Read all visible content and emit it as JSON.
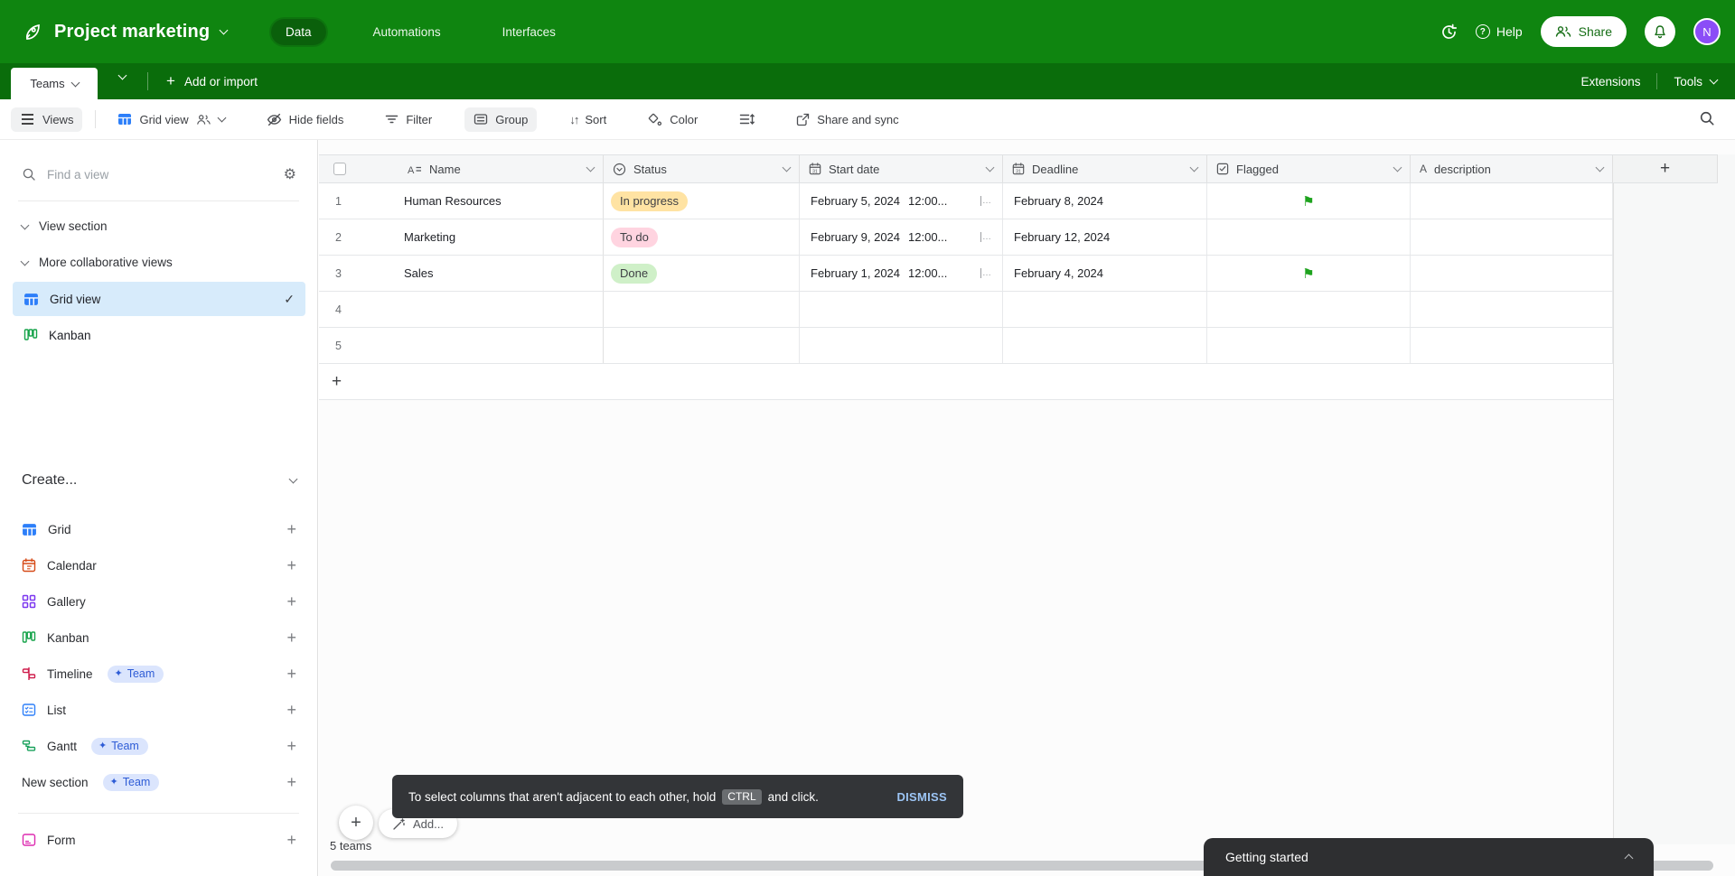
{
  "colors": {
    "brand_green": "#0f8510",
    "brand_green_dark": "#0a6d0b",
    "selected_view_bg": "#d7ebfb",
    "flag_green": "#1ea31e",
    "avatar_purple": "#8b4df7",
    "status_in_progress_bg": "#ffe3a3",
    "status_to_do_bg": "#ffd4e0",
    "status_done_bg": "#cff0c8"
  },
  "icons": {
    "plus": "+",
    "check": "✓",
    "sparkle": "✦",
    "gear": "⚙",
    "question_mark": "?",
    "sort": "↓↑",
    "flag": "⚑",
    "letter_a": "A"
  },
  "topbar": {
    "title": "Project marketing",
    "tabs": [
      {
        "label": "Data"
      },
      {
        "label": "Automations"
      },
      {
        "label": "Interfaces"
      }
    ],
    "help": "Help",
    "share": "Share",
    "avatar": "N"
  },
  "tabrow": {
    "active_table": "Teams",
    "add_or_import": "Add or import",
    "extensions": "Extensions",
    "tools": "Tools"
  },
  "toolbar": {
    "views": "Views",
    "view_name": "Grid view",
    "hide_fields": "Hide fields",
    "filter": "Filter",
    "group": "Group",
    "sort": "Sort",
    "color": "Color",
    "share_sync": "Share and sync"
  },
  "sidebar": {
    "find_placeholder": "Find a view",
    "section1": "View section",
    "section2": "More collaborative views",
    "views": [
      {
        "label": "Grid view",
        "selected": true
      },
      {
        "label": "Kanban"
      }
    ],
    "create": "Create...",
    "create_items": [
      {
        "label": "Grid"
      },
      {
        "label": "Calendar"
      },
      {
        "label": "Gallery"
      },
      {
        "label": "Kanban"
      },
      {
        "label": "Timeline",
        "badge": "Team"
      },
      {
        "label": "List"
      },
      {
        "label": "Gantt",
        "badge": "Team"
      },
      {
        "label": "New section",
        "badge": "Team"
      },
      {
        "label": "Form"
      }
    ]
  },
  "table": {
    "headers": {
      "name": "Name",
      "status": "Status",
      "start": "Start date",
      "deadline": "Deadline",
      "flagged": "Flagged",
      "description": "description"
    },
    "rows": [
      {
        "num": "1",
        "name": "Human Resources",
        "status": "In progress",
        "status_bg": "#ffe3a3",
        "start_date": "February 5, 2024",
        "start_time": "12:00...",
        "deadline": "February 8, 2024",
        "flagged": true
      },
      {
        "num": "2",
        "name": "Marketing",
        "status": "To do",
        "status_bg": "#ffd4e0",
        "start_date": "February 9, 2024",
        "start_time": "12:00...",
        "deadline": "February 12, 2024",
        "flagged": false
      },
      {
        "num": "3",
        "name": "Sales",
        "status": "Done",
        "status_bg": "#cff0c8",
        "start_date": "February 1, 2024",
        "start_time": "12:00...",
        "deadline": "February 4, 2024",
        "flagged": true
      },
      {
        "num": "4"
      },
      {
        "num": "5"
      }
    ],
    "record_count": "5 teams",
    "add_record": "Add..."
  },
  "toast": {
    "message": "To select columns that aren't adjacent to each other, hold",
    "key": "CTRL",
    "suffix": "and click.",
    "dismiss": "DISMISS"
  },
  "getting_started": "Getting started"
}
